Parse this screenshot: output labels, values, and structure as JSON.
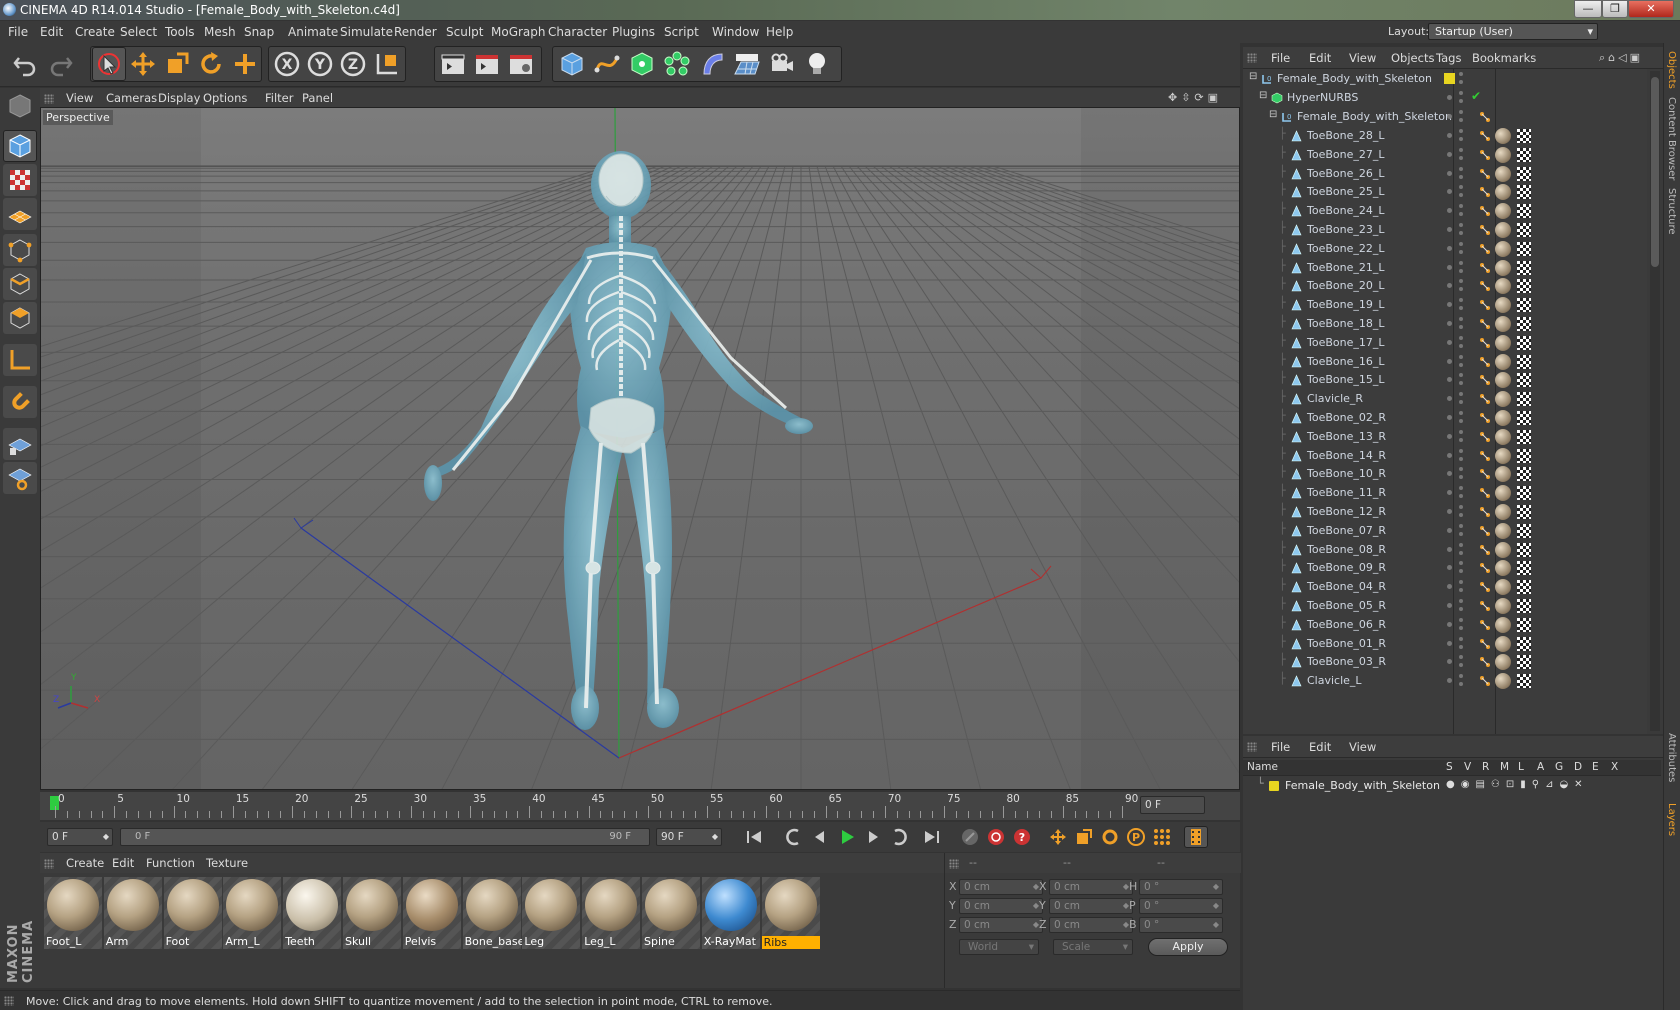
{
  "window": {
    "title": "CINEMA 4D R14.014 Studio - [Female_Body_with_Skeleton.c4d]",
    "minimize": "—",
    "maximize": "❐",
    "close": "✕"
  },
  "menu": [
    "File",
    "Edit",
    "Create",
    "Select",
    "Tools",
    "Mesh",
    "Snap",
    "Animate",
    "Simulate",
    "Render",
    "Sculpt",
    "MoGraph",
    "Character",
    "Plugins",
    "Script",
    "Window",
    "Help"
  ],
  "layout": {
    "label": "Layout:",
    "value": "Startup (User)"
  },
  "viewport": {
    "menu": [
      "View",
      "Cameras",
      "Display",
      "Options",
      "Filter",
      "Panel"
    ],
    "camera_label": "Perspective",
    "axis_x": "X",
    "axis_y": "Y",
    "axis_z": "Z"
  },
  "timeline": {
    "ticks": [
      "0",
      "5",
      "10",
      "15",
      "20",
      "25",
      "30",
      "35",
      "40",
      "45",
      "50",
      "55",
      "60",
      "65",
      "70",
      "75",
      "80",
      "85",
      "90"
    ],
    "current_frame": "0 F"
  },
  "transport": {
    "start_field": "0 F",
    "range_start": "0 F",
    "range_end": "90 F",
    "end_field": "90 F"
  },
  "materials": {
    "menu": [
      "Create",
      "Edit",
      "Function",
      "Texture"
    ],
    "items": [
      "Foot_L",
      "Arm",
      "Foot",
      "Arm_L",
      "Teeth",
      "Skull",
      "Pelvis",
      "Bone_base",
      "Leg",
      "Leg_L",
      "Spine",
      "X-RayMat",
      "Ribs"
    ],
    "selected": "Ribs"
  },
  "coords": {
    "headers": [
      "--",
      "--",
      "--"
    ],
    "row1": {
      "l1": "X",
      "v1": "0 cm",
      "l2": "X",
      "v2": "0 cm",
      "l3": "H",
      "v3": "0 °"
    },
    "row2": {
      "l1": "Y",
      "v1": "0 cm",
      "l2": "Y",
      "v2": "0 cm",
      "l3": "P",
      "v3": "0 °"
    },
    "row3": {
      "l1": "Z",
      "v1": "0 cm",
      "l2": "Z",
      "v2": "0 cm",
      "l3": "B",
      "v3": "0 °"
    },
    "world": "World",
    "scale": "Scale",
    "apply": "Apply"
  },
  "status": "Move: Click and drag to move elements. Hold down SHIFT to quantize movement / add to the selection in point mode, CTRL to remove.",
  "object_manager": {
    "menu": [
      "File",
      "Edit",
      "View",
      "Objects",
      "Tags",
      "Bookmarks"
    ],
    "root": "Female_Body_with_Skeleton",
    "hypernurbs": "HyperNURBS",
    "child": "Female_Body_with_Skeleton",
    "bones": [
      "ToeBone_28_L",
      "ToeBone_27_L",
      "ToeBone_26_L",
      "ToeBone_25_L",
      "ToeBone_24_L",
      "ToeBone_23_L",
      "ToeBone_22_L",
      "ToeBone_21_L",
      "ToeBone_20_L",
      "ToeBone_19_L",
      "ToeBone_18_L",
      "ToeBone_17_L",
      "ToeBone_16_L",
      "ToeBone_15_L",
      "Clavicle_R",
      "ToeBone_02_R",
      "ToeBone_13_R",
      "ToeBone_14_R",
      "ToeBone_10_R",
      "ToeBone_11_R",
      "ToeBone_12_R",
      "ToeBone_07_R",
      "ToeBone_08_R",
      "ToeBone_09_R",
      "ToeBone_04_R",
      "ToeBone_05_R",
      "ToeBone_06_R",
      "ToeBone_01_R",
      "ToeBone_03_R",
      "Clavicle_L"
    ]
  },
  "layer_manager": {
    "menu": [
      "File",
      "Edit",
      "View"
    ],
    "columns": [
      "Name",
      "S",
      "V",
      "R",
      "M",
      "L",
      "A",
      "G",
      "D",
      "E",
      "X"
    ],
    "rows": [
      "Female_Body_with_Skeleton"
    ]
  },
  "side_tabs": {
    "objects": "Objects",
    "content": "Content Browser",
    "structure": "Structure",
    "attributes": "Attributes",
    "layers": "Layers"
  },
  "brand": "MAXON CINEMA 4D",
  "colors": {
    "accent": "#f0a028",
    "selection": "#ffb000"
  }
}
